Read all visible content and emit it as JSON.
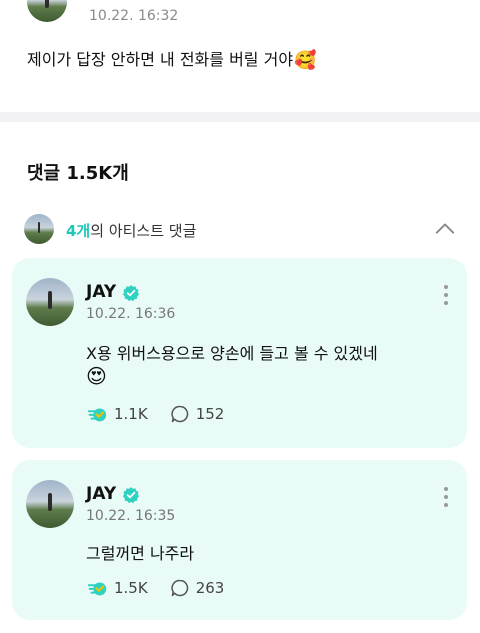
{
  "post": {
    "time": "10.22. 16:32",
    "text": "제이가 답장 안하면 내 전화를 버릴 거야",
    "emoji": "🥰"
  },
  "comments": {
    "title": "댓글 1.5K개",
    "artist_count": "4개",
    "artist_label": "의 아티스트 댓글"
  },
  "cards": [
    {
      "name": "JAY",
      "time": "10.22. 16:36",
      "text": "X용 위버스용으로 양손에 들고 볼 수 있겠네",
      "emoji": "😍",
      "likes": "1.1K",
      "replies": "152"
    },
    {
      "name": "JAY",
      "time": "10.22. 16:35",
      "text": "그럴꺼면 나주라",
      "likes": "1.5K",
      "replies": "263"
    }
  ],
  "colors": {
    "accent": "#1cc8b8",
    "card_bg": "#e9fbf7",
    "verified": "#2fd1c1"
  },
  "icons": {
    "verified": "verified-badge-icon",
    "like": "weverse-like-icon",
    "reply": "speech-bubble-icon",
    "more": "more-vertical-icon",
    "collapse": "chevron-up-icon"
  }
}
